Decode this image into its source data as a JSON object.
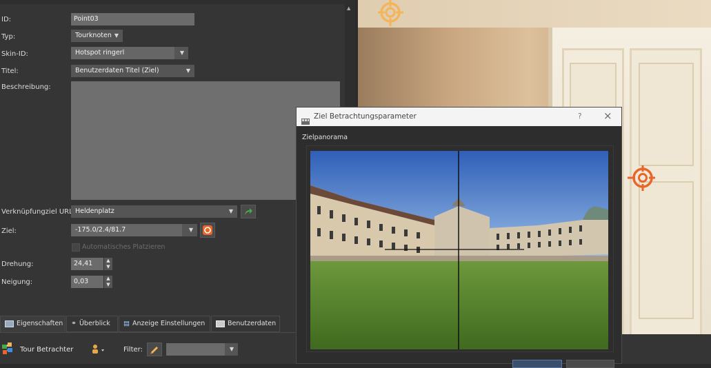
{
  "props": {
    "id": {
      "label": "ID:",
      "value": "Point03"
    },
    "typ": {
      "label": "Typ:",
      "value": "Tourknoten"
    },
    "skin": {
      "label": "Skin-ID:",
      "value": "Hotspot ringerl"
    },
    "titel": {
      "label": "Titel:",
      "value": "Benutzerdaten Titel (Ziel)"
    },
    "beschreibung": {
      "label": "Beschreibung:",
      "value": ""
    },
    "link": {
      "label": "Verknüpfungziel URL:",
      "value": "Heldenplatz"
    },
    "ziel": {
      "label": "Ziel:",
      "value": "-175.0/2.4/81.7"
    },
    "auto_place": {
      "label": "Automatisches Platzieren",
      "checked": false
    },
    "drehung": {
      "label": "Drehung:",
      "value": "24,41"
    },
    "neigung": {
      "label": "Neigung:",
      "value": "0,03"
    }
  },
  "tabs": [
    {
      "label": "Eigenschaften",
      "icon": "properties-icon"
    },
    {
      "label": "Überblick",
      "icon": "binoculars-icon"
    },
    {
      "label": "Anzeige Einstellungen",
      "icon": "display-settings-icon"
    },
    {
      "label": "Benutzerdaten",
      "icon": "userdata-icon"
    }
  ],
  "bottom_toolbar": {
    "tour_label": "Tour Betrachter",
    "filter_label": "Filter:",
    "filter_value": ""
  },
  "dialog": {
    "title": "Ziel Betrachtungsparameter",
    "help": "?",
    "close": "×",
    "section": "Zielpanorama"
  },
  "colors": {
    "hotspot_orange": "#e8662a",
    "hotspot_gold": "#f2b55a",
    "link_arrow_green": "#3fae49",
    "target_button": "#e8662a"
  }
}
